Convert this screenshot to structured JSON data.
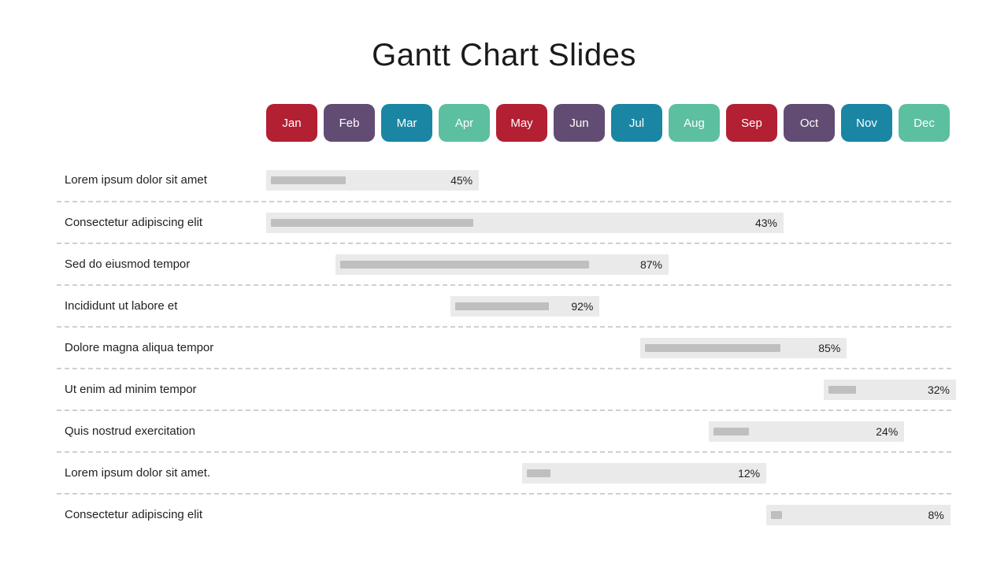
{
  "title": "Gantt Chart Slides",
  "month_colors": {
    "red": "#b31f33",
    "purple": "#634c73",
    "teal": "#1a86a3",
    "green": "#5cbfa0"
  },
  "months": [
    {
      "label": "Jan",
      "color": "red"
    },
    {
      "label": "Feb",
      "color": "purple"
    },
    {
      "label": "Mar",
      "color": "teal"
    },
    {
      "label": "Apr",
      "color": "green"
    },
    {
      "label": "May",
      "color": "red"
    },
    {
      "label": "Jun",
      "color": "purple"
    },
    {
      "label": "Jul",
      "color": "teal"
    },
    {
      "label": "Aug",
      "color": "green"
    },
    {
      "label": "Sep",
      "color": "red"
    },
    {
      "label": "Oct",
      "color": "purple"
    },
    {
      "label": "Nov",
      "color": "teal"
    },
    {
      "label": "Dec",
      "color": "green"
    }
  ],
  "chart_data": {
    "type": "bar",
    "title": "Gantt Chart Slides",
    "xlabel": "",
    "ylabel": "",
    "x_categories": [
      "Jan",
      "Feb",
      "Mar",
      "Apr",
      "May",
      "Jun",
      "Jul",
      "Aug",
      "Sep",
      "Oct",
      "Nov",
      "Dec"
    ],
    "tasks": [
      {
        "label": "Lorem ipsum dolor sit amet",
        "start_month": 0,
        "span_months": 3.7,
        "progress_pct": 45
      },
      {
        "label": "Consectetur adipiscing elit",
        "start_month": 0,
        "span_months": 9.0,
        "progress_pct": 43
      },
      {
        "label": "Sed do eiusmod tempor",
        "start_month": 1.2,
        "span_months": 5.8,
        "progress_pct": 87
      },
      {
        "label": "Incididunt ut labore et",
        "start_month": 3.2,
        "span_months": 2.6,
        "progress_pct": 92
      },
      {
        "label": "Dolore magna aliqua tempor",
        "start_month": 6.5,
        "span_months": 3.6,
        "progress_pct": 85
      },
      {
        "label": "Ut enim ad minim tempor",
        "start_month": 9.7,
        "span_months": 2.3,
        "progress_pct": 32
      },
      {
        "label": "Quis nostrud exercitation",
        "start_month": 7.7,
        "span_months": 3.4,
        "progress_pct": 24
      },
      {
        "label": "Lorem ipsum dolor sit amet.",
        "start_month": 4.45,
        "span_months": 4.25,
        "progress_pct": 12
      },
      {
        "label": "Consectetur adipiscing elit",
        "start_month": 8.7,
        "span_months": 3.2,
        "progress_pct": 8
      }
    ]
  }
}
